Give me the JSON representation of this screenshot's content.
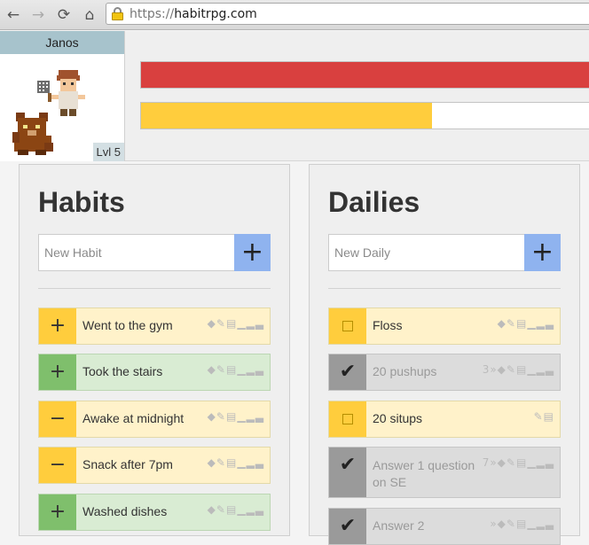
{
  "browser": {
    "url_protocol": "https://",
    "url_host": "habitrpg.com"
  },
  "header": {
    "username": "Janos",
    "level": "Lvl 5",
    "health_fraction": 1.0,
    "experience_fraction": 0.645
  },
  "habits": {
    "title": "Habits",
    "new_placeholder": "New Habit",
    "add_label": "+",
    "items": [
      {
        "label": "Went to the gym",
        "control": "+",
        "color": "yellow"
      },
      {
        "label": "Took the stairs",
        "control": "+",
        "color": "green"
      },
      {
        "label": "Awake at midnight",
        "control": "−",
        "color": "yellow"
      },
      {
        "label": "Snack after 7pm",
        "control": "−",
        "color": "yellow"
      },
      {
        "label": "Washed dishes",
        "control": "+",
        "color": "green"
      }
    ]
  },
  "dailies": {
    "title": "Dailies",
    "new_placeholder": "New Daily",
    "add_label": "+",
    "items": [
      {
        "label": "Floss",
        "completed": false,
        "streak": ""
      },
      {
        "label": "20 pushups",
        "completed": true,
        "streak": "3"
      },
      {
        "label": "20 situps",
        "completed": false,
        "streak": ""
      },
      {
        "label": "Answer 1 question on SE",
        "completed": true,
        "streak": "7"
      },
      {
        "label": "Answer 2",
        "completed": true,
        "streak": ""
      }
    ]
  },
  "icons": {
    "tag": "tag-icon",
    "edit": "pencil-icon",
    "delete": "trash-icon",
    "stats": "bar-chart-icon",
    "streak": "fast-forward-icon"
  }
}
